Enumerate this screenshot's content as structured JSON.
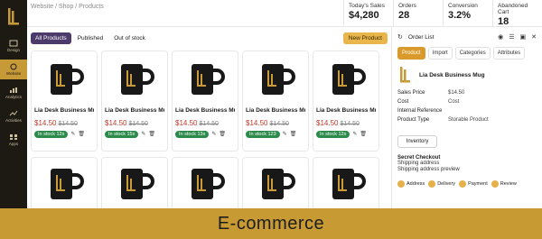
{
  "breadcrumb": "Website / Shop / Products",
  "stats": [
    {
      "label": "Today's Sales",
      "value": "$4,280"
    },
    {
      "label": "Orders",
      "value": "28"
    },
    {
      "label": "Conversion",
      "value": "3.2%"
    },
    {
      "label": "Abandoned Cart",
      "value": "18"
    }
  ],
  "sidebar": {
    "items": [
      {
        "label": "Design",
        "icon": "design-icon"
      },
      {
        "label": "Website",
        "icon": "website-icon",
        "active": true
      },
      {
        "label": "Analytics",
        "icon": "analytics-icon"
      },
      {
        "label": "Activities",
        "icon": "activities-icon"
      },
      {
        "label": "Apps",
        "icon": "apps-icon"
      }
    ]
  },
  "filters": {
    "all": "All Products",
    "published": "Published",
    "out_of_stock": "Out of stock",
    "new_button": "New Product"
  },
  "products": [
    {
      "name": "Lia Desk Business Mug",
      "price": "$14.50",
      "old_price": "$14.50",
      "stock": "In stock 12x"
    },
    {
      "name": "Lia Desk Business Mug",
      "price": "$14.50",
      "old_price": "$14.50",
      "stock": "In stock 15x"
    },
    {
      "name": "Lia Desk Business Mug",
      "price": "$14.50",
      "old_price": "$14.50",
      "stock": "In stock 13x"
    },
    {
      "name": "Lia Desk Business Mug",
      "price": "$14.50",
      "old_price": "$14.50",
      "stock": "In stock 123"
    },
    {
      "name": "Lia Desk Business Mug",
      "price": "$14.50",
      "old_price": "$14.50",
      "stock": "In stock 12x"
    }
  ],
  "panel": {
    "title": "Order List",
    "tabs": [
      "Product",
      "Import",
      "Categories",
      "Attributes"
    ],
    "product_title": "Lia Desk Business Mug",
    "details": [
      {
        "k": "Sales Price",
        "v": "$14.50"
      },
      {
        "k": "Cost",
        "v": "Cost"
      },
      {
        "k": "Internal Reference",
        "v": ""
      },
      {
        "k": "Product Type",
        "v": "Storable Product"
      }
    ],
    "inventory_button": "Inventory",
    "checkout": {
      "title": "Secret Checkout",
      "line1": "Shipping address",
      "line2": "Shipping address preview"
    },
    "steps": [
      "Address",
      "Delivery",
      "Payment",
      "Review"
    ]
  },
  "footer": "E-commerce",
  "colors": {
    "accent": "#c89a34",
    "sidebar": "#1d1a14",
    "active_chip": "#4c3a6a",
    "stock_badge": "#2c8a4b"
  }
}
